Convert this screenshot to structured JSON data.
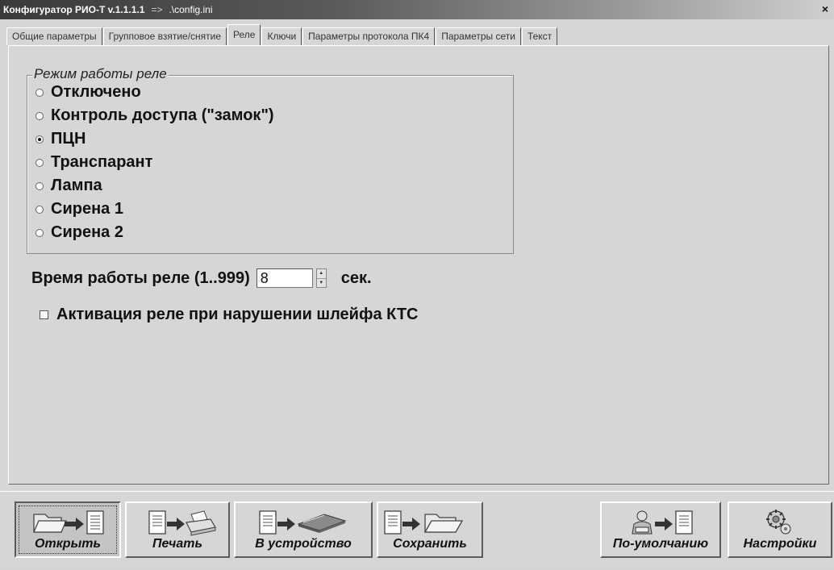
{
  "window": {
    "title": "Конфигуратор РИО-Т v.1.1.1.1",
    "title_arrow": "=>",
    "title_file": ".\\config.ini",
    "close_label": "×"
  },
  "tabs": [
    {
      "label": "Общие параметры",
      "active": false
    },
    {
      "label": "Групповое взятие/снятие",
      "active": false
    },
    {
      "label": "Реле",
      "active": true
    },
    {
      "label": "Ключи",
      "active": false
    },
    {
      "label": "Параметры протокола ПК4",
      "active": false
    },
    {
      "label": "Параметры сети",
      "active": false
    },
    {
      "label": "Текст",
      "active": false
    }
  ],
  "relay_mode": {
    "legend": "Режим работы реле",
    "options": [
      {
        "label": "Отключено",
        "checked": false
      },
      {
        "label": "Контроль доступа (\"замок\")",
        "checked": false
      },
      {
        "label": "ПЦН",
        "checked": true
      },
      {
        "label": "Транспарант",
        "checked": false
      },
      {
        "label": "Лампа",
        "checked": false
      },
      {
        "label": "Сирена 1",
        "checked": false
      },
      {
        "label": "Сирена 2",
        "checked": false
      }
    ]
  },
  "relay_time": {
    "label": "Время работы реле (1..999)",
    "value": "8",
    "unit": "сек."
  },
  "activation": {
    "label": "Активация реле при нарушении шлейфа КТС",
    "checked": false
  },
  "toolbar": {
    "open_label": "Открыть",
    "print_label": "Печать",
    "to_device_label": "В устройство",
    "save_label": "Сохранить",
    "defaults_label": "По-умолчанию",
    "settings_label": "Настройки"
  }
}
